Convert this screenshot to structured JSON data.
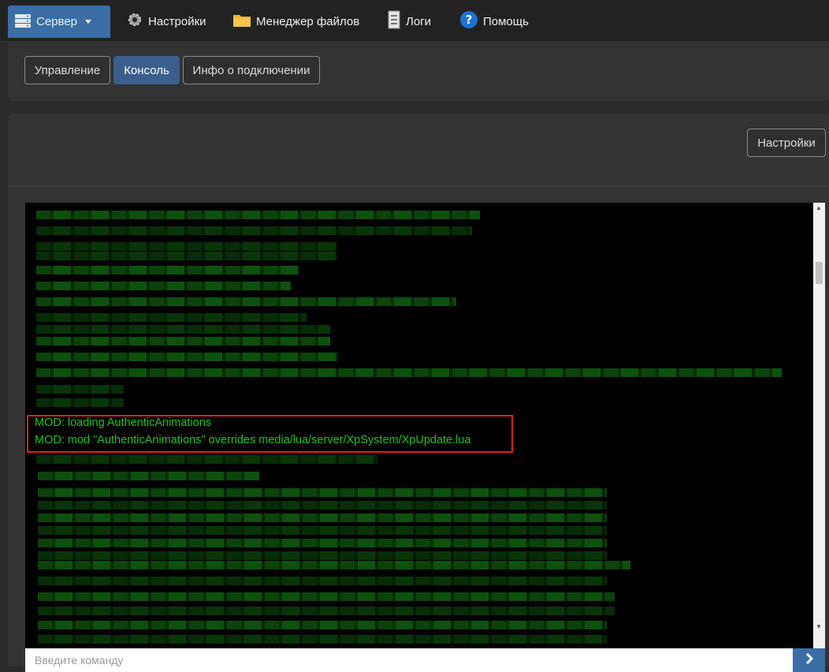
{
  "navbar": {
    "server": "Сервер",
    "settings": "Настройки",
    "file_manager": "Менеджер файлов",
    "logs": "Логи",
    "help": "Помощь"
  },
  "subtabs": {
    "manage": "Управление",
    "console": "Консоль",
    "connection_info": "Инфо о подключении"
  },
  "console_panel": {
    "settings_button": "Настройки",
    "highlighted_lines": [
      "MOD: loading AuthenticAnimations",
      "MOD: mod \"AuthenticAnimations\" overrides media/lua/server/XpSystem/XpUpdate.lua"
    ],
    "text_color": "#1fc21f",
    "highlight_color": "#e01e1e"
  },
  "command": {
    "placeholder": "Введите команду"
  },
  "colors": {
    "accent": "#3a6ea5",
    "background": "#2b2b2b"
  }
}
